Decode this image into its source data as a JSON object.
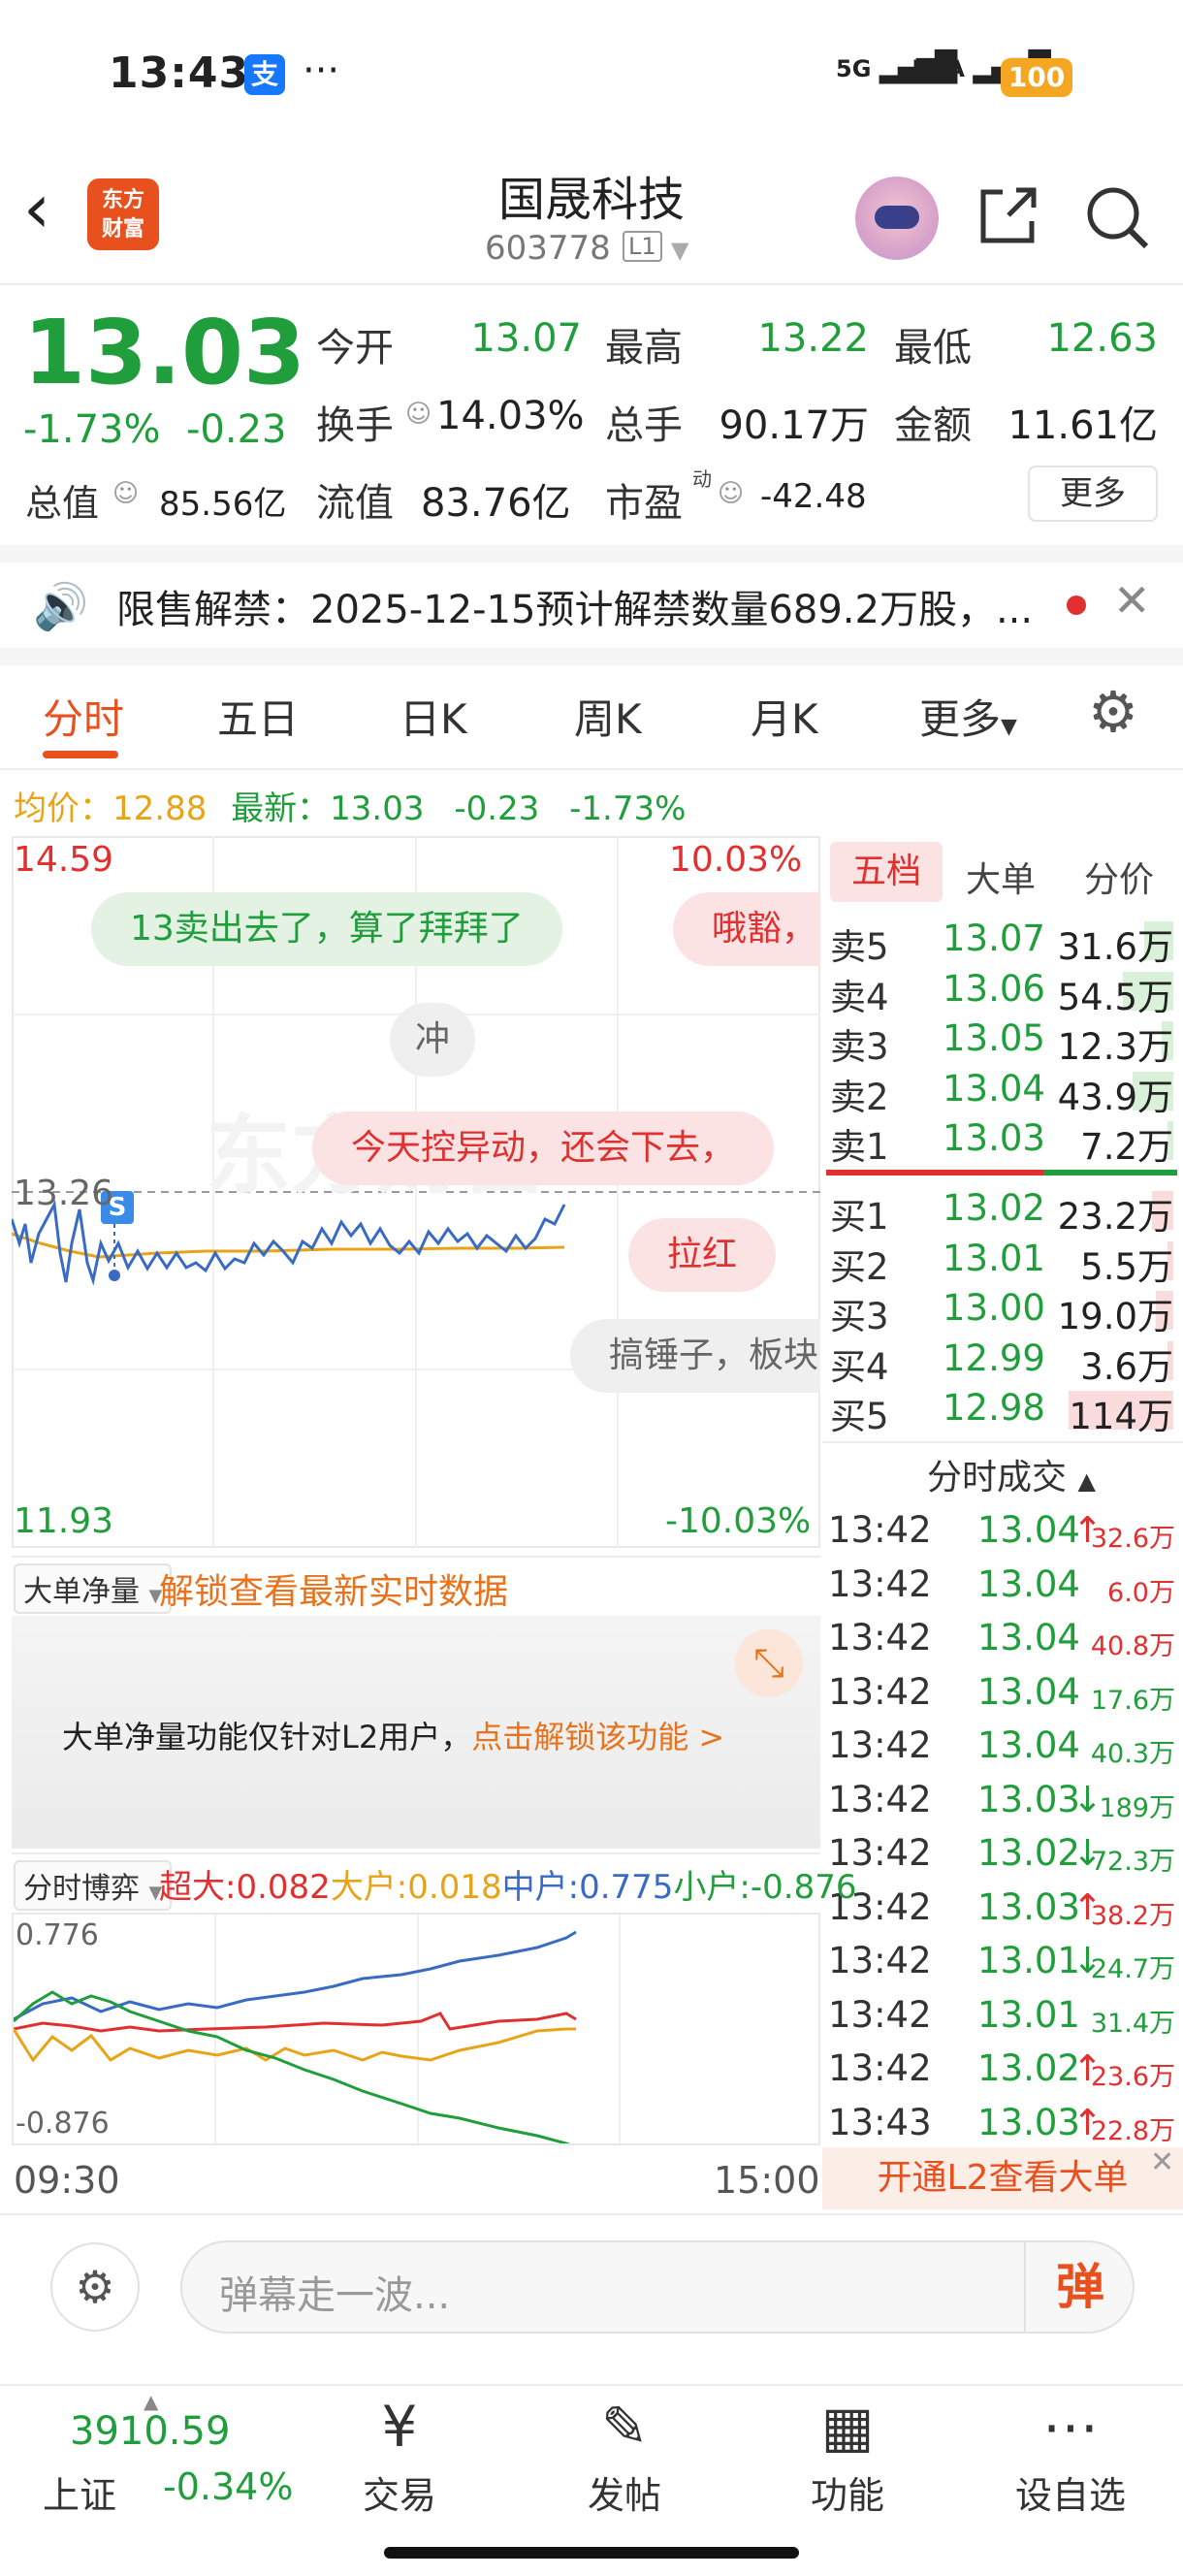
{
  "status_bar": {
    "time": "13:43",
    "alipay_icon": "支",
    "more": "···",
    "signal1": "5G",
    "signal2": "5GA",
    "battery": "100"
  },
  "header": {
    "logo_line1": "东方",
    "logo_line2": "财富",
    "stock_name": "国晟科技",
    "stock_code": "603778",
    "level": "L1"
  },
  "quote": {
    "price": "13.03",
    "change_pct": "-1.73%",
    "change": "-0.23",
    "open_label": "今开",
    "open": "13.07",
    "high_label": "最高",
    "high": "13.22",
    "low_label": "最低",
    "low": "12.63",
    "turnover_label": "换手",
    "turnover": "14.03%",
    "volume_label": "总手",
    "volume": "90.17万",
    "amount_label": "金额",
    "amount": "11.61亿",
    "mktcap_label": "总值",
    "mktcap": "85.56亿",
    "float_label": "流值",
    "float_cap": "83.76亿",
    "pe_label": "市盈",
    "pe_sup": "动",
    "pe": "-42.48",
    "more_label": "更多"
  },
  "notice": {
    "text": "限售解禁：2025-12-15预计解禁数量689.2万股，..."
  },
  "tabs": [
    "分时",
    "五日",
    "日K",
    "周K",
    "月K",
    "更多"
  ],
  "avg_line": {
    "avg_label": "均价：",
    "avg": "12.88",
    "latest_label": "最新：",
    "latest": "13.03",
    "chg": "-0.23",
    "pct": "-1.73%"
  },
  "chart": {
    "y_top": "14.59",
    "y_bottom": "11.93",
    "pct_top": "10.03%",
    "pct_bottom": "-10.03%",
    "prev_close": "13.26",
    "s_marker": "S",
    "watermark": "东方财富",
    "x_start": "09:30",
    "x_end": "15:00",
    "bubbles": [
      "13卖出去了，算了拜拜了",
      "哦豁，",
      "冲",
      "今天控异动，还会下去，",
      "拉红",
      "搞锤子，板块"
    ]
  },
  "order_book": {
    "tabs": [
      "五档",
      "大单",
      "分价"
    ],
    "asks": [
      {
        "label": "卖5",
        "price": "13.07",
        "vol": "31.6万",
        "ratio": 0.28
      },
      {
        "label": "卖4",
        "price": "13.06",
        "vol": "54.5万",
        "ratio": 0.48
      },
      {
        "label": "卖3",
        "price": "13.05",
        "vol": "12.3万",
        "ratio": 0.11
      },
      {
        "label": "卖2",
        "price": "13.04",
        "vol": "43.9万",
        "ratio": 0.39
      },
      {
        "label": "卖1",
        "price": "13.03",
        "vol": "7.2万",
        "ratio": 0.06
      }
    ],
    "bids": [
      {
        "label": "买1",
        "price": "13.02",
        "vol": "23.2万",
        "ratio": 0.2
      },
      {
        "label": "买2",
        "price": "13.01",
        "vol": "5.5万",
        "ratio": 0.05
      },
      {
        "label": "买3",
        "price": "13.00",
        "vol": "19.0万",
        "ratio": 0.17
      },
      {
        "label": "买4",
        "price": "12.99",
        "vol": "3.6万",
        "ratio": 0.03
      },
      {
        "label": "买5",
        "price": "12.98",
        "vol": "114万",
        "ratio": 1.0
      }
    ]
  },
  "ticks": {
    "title": "分时成交",
    "rows": [
      {
        "time": "13:42",
        "price": "13.04",
        "arrow": "↑",
        "vol": "32.6万",
        "color": "red"
      },
      {
        "time": "13:42",
        "price": "13.04",
        "arrow": "",
        "vol": "6.0万",
        "color": "red"
      },
      {
        "time": "13:42",
        "price": "13.04",
        "arrow": "",
        "vol": "40.8万",
        "color": "red"
      },
      {
        "time": "13:42",
        "price": "13.04",
        "arrow": "",
        "vol": "17.6万",
        "color": "green"
      },
      {
        "time": "13:42",
        "price": "13.04",
        "arrow": "",
        "vol": "40.3万",
        "color": "green"
      },
      {
        "time": "13:42",
        "price": "13.03",
        "arrow": "↓",
        "vol": "189万",
        "color": "green"
      },
      {
        "time": "13:42",
        "price": "13.02",
        "arrow": "↓",
        "vol": "72.3万",
        "color": "green"
      },
      {
        "time": "13:42",
        "price": "13.03",
        "arrow": "↑",
        "vol": "38.2万",
        "color": "red"
      },
      {
        "time": "13:42",
        "price": "13.01",
        "arrow": "↓",
        "vol": "24.7万",
        "color": "green"
      },
      {
        "time": "13:42",
        "price": "13.01",
        "arrow": "",
        "vol": "31.4万",
        "color": "green"
      },
      {
        "time": "13:42",
        "price": "13.02",
        "arrow": "↑",
        "vol": "23.6万",
        "color": "red"
      },
      {
        "time": "13:43",
        "price": "13.03",
        "arrow": "↑",
        "vol": "22.8万",
        "color": "red"
      }
    ],
    "l2_banner": "开通L2查看大单"
  },
  "big_order": {
    "dropdown": "大单净量",
    "unlock_text": "解锁查看最新实时数据",
    "info": "大单净量功能仅针对L2用户，",
    "link": "点击解锁该功能 >"
  },
  "game": {
    "dropdown": "分时博弈",
    "super_label": "超大:",
    "super_val": "0.082",
    "big_label": "大户:",
    "big_val": "0.018",
    "mid_label": "中户:",
    "mid_val": "0.775",
    "small_label": "小户:",
    "small_val": "-0.876",
    "y_top": "0.776",
    "y_bottom": "-0.876"
  },
  "danmu": {
    "placeholder": "弹幕走一波...",
    "send": "弹"
  },
  "bottom_nav": {
    "index_value": "3910.59",
    "index_name": "上证",
    "index_chg": "-0.34%",
    "items": [
      "交易",
      "发帖",
      "功能",
      "设自选"
    ]
  },
  "colors": {
    "up": "#e03030",
    "down": "#1f9e3b",
    "accent": "#e8501e",
    "avg": "#e8a317",
    "price_line": "#3a6bc4"
  }
}
